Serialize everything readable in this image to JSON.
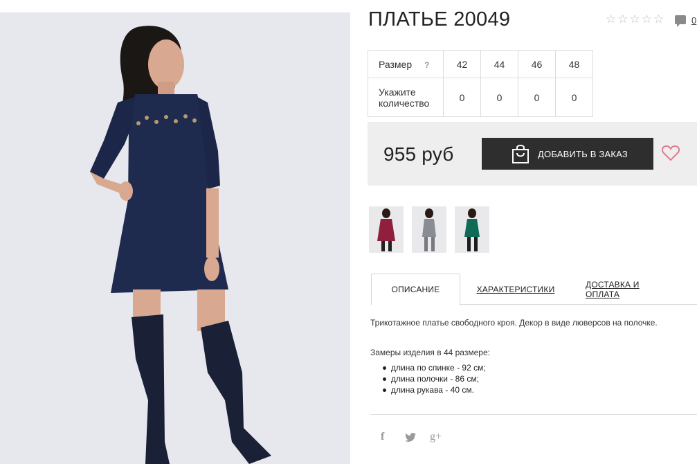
{
  "product": {
    "title": "ПЛАТЬЕ 20049",
    "rating_stars": [
      "☆",
      "☆",
      "☆",
      "☆",
      "☆"
    ],
    "comments_count": "0",
    "icons": {
      "rating": "star-outline-icon",
      "comments": "comment-bubble-icon"
    }
  },
  "size_table": {
    "size_label": "Размер",
    "help_mark": "?",
    "quantity_label_line1": "Укажите",
    "quantity_label_line2": "количество",
    "sizes": [
      "42",
      "44",
      "46",
      "48"
    ],
    "quantities": [
      "0",
      "0",
      "0",
      "0"
    ]
  },
  "buy": {
    "price": "955 руб",
    "add_button": "ДОБАВИТЬ В ЗАКАЗ",
    "icons": {
      "cart": "shopping-bag-icon",
      "wishlist": "heart-outline-icon"
    },
    "colors": {
      "button_bg": "#2e2e2e",
      "heart": "#e07a8a",
      "panel_bg": "#eeeeee"
    }
  },
  "thumbnails": [
    {
      "color": "#8f1f3c"
    },
    {
      "color": "#8a8c94"
    },
    {
      "color": "#0f6b56"
    }
  ],
  "tabs": [
    "ОПИСАНИЕ",
    "ХАРАКТЕРИСТИКИ",
    "ДОСТАВКА И ОПЛАТА"
  ],
  "description": {
    "text": "Трикотажное платье свободного кроя. Декор в виде люверсов на полочке.",
    "measurements_title": "Замеры изделия в 44 размере:",
    "measurements": [
      "длина по спинке - 92 см;",
      "длина полочки - 86 см;",
      "длина рукава - 40 см."
    ]
  },
  "social": {
    "facebook": "f",
    "twitter": "🐦",
    "googleplus": "g+"
  },
  "photo": {
    "dress_color": "#1f2a4f",
    "boots_color": "#1a2036"
  }
}
